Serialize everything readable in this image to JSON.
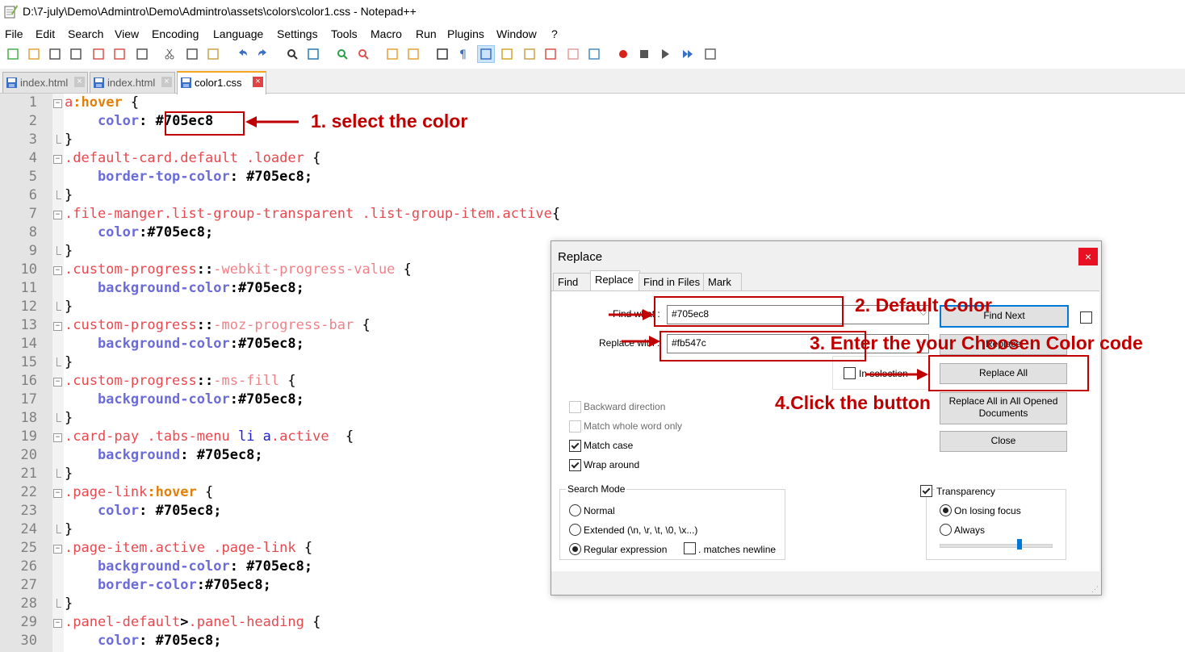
{
  "window": {
    "title": "D:\\7-july\\Demo\\Admintro\\Demo\\Admintro\\assets\\colors\\color1.css - Notepad++"
  },
  "menu": [
    "File",
    "Edit",
    "Search",
    "View",
    "Encoding",
    "Language",
    "Settings",
    "Tools",
    "Macro",
    "Run",
    "Plugins",
    "Window",
    "?"
  ],
  "tabs": [
    {
      "label": "index.html",
      "active": false
    },
    {
      "label": "index.html",
      "active": false
    },
    {
      "label": "color1.css",
      "active": true
    }
  ],
  "code_lines": [
    {
      "n": "1",
      "t": [
        [
          "a",
          "s-red"
        ],
        [
          ":hover",
          "s-or"
        ],
        [
          " {",
          "s-bl"
        ]
      ]
    },
    {
      "n": "2",
      "t": [
        [
          "    color",
          "s-blue"
        ],
        [
          ": ",
          "s-dk"
        ],
        [
          "#705ec8",
          "s-dk"
        ]
      ]
    },
    {
      "n": "3",
      "t": [
        [
          "}",
          "s-bl"
        ]
      ]
    },
    {
      "n": "4",
      "t": [
        [
          ".default-card.default",
          "s-red"
        ],
        [
          " .loader",
          "s-red"
        ],
        [
          " {",
          "s-bl"
        ]
      ]
    },
    {
      "n": "5",
      "t": [
        [
          "    border-top-color",
          "s-blue"
        ],
        [
          ": #705ec8;",
          "s-dk"
        ]
      ]
    },
    {
      "n": "6",
      "t": [
        [
          "}",
          "s-bl"
        ]
      ]
    },
    {
      "n": "7",
      "t": [
        [
          ".file-manger.list-group-transparent",
          "s-red"
        ],
        [
          " .list-group-item.active",
          "s-red"
        ],
        [
          "{",
          "s-bl"
        ]
      ]
    },
    {
      "n": "8",
      "t": [
        [
          "    color",
          "s-blue"
        ],
        [
          ":#705ec8;",
          "s-dk"
        ]
      ]
    },
    {
      "n": "9",
      "t": [
        [
          "}",
          "s-bl"
        ]
      ]
    },
    {
      "n": "10",
      "t": [
        [
          ".custom-progress",
          "s-red"
        ],
        [
          "::",
          "s-dk"
        ],
        [
          "-webkit-progress-value",
          "s-pk"
        ],
        [
          " {",
          "s-bl"
        ]
      ]
    },
    {
      "n": "11",
      "t": [
        [
          "    background-color",
          "s-blue"
        ],
        [
          ":#705ec8;",
          "s-dk"
        ]
      ]
    },
    {
      "n": "12",
      "t": [
        [
          "}",
          "s-bl"
        ]
      ]
    },
    {
      "n": "13",
      "t": [
        [
          ".custom-progress",
          "s-red"
        ],
        [
          "::",
          "s-dk"
        ],
        [
          "-moz-progress-bar",
          "s-pk"
        ],
        [
          " {",
          "s-bl"
        ]
      ]
    },
    {
      "n": "14",
      "t": [
        [
          "    background-color",
          "s-blue"
        ],
        [
          ":#705ec8;",
          "s-dk"
        ]
      ]
    },
    {
      "n": "15",
      "t": [
        [
          "}",
          "s-bl"
        ]
      ]
    },
    {
      "n": "16",
      "t": [
        [
          ".custom-progress",
          "s-red"
        ],
        [
          "::",
          "s-dk"
        ],
        [
          "-ms-fill",
          "s-pk"
        ],
        [
          " {",
          "s-bl"
        ]
      ]
    },
    {
      "n": "17",
      "t": [
        [
          "    background-color",
          "s-blue"
        ],
        [
          ":#705ec8;",
          "s-dk"
        ]
      ]
    },
    {
      "n": "18",
      "t": [
        [
          "}",
          "s-bl"
        ]
      ]
    },
    {
      "n": "19",
      "t": [
        [
          ".card-pay",
          "s-red"
        ],
        [
          " .tabs-menu",
          "s-red"
        ],
        [
          " li",
          "s-nv"
        ],
        [
          " a",
          "s-nv"
        ],
        [
          ".active",
          "s-red"
        ],
        [
          "  {",
          "s-bl"
        ]
      ]
    },
    {
      "n": "20",
      "t": [
        [
          "    background",
          "s-blue"
        ],
        [
          ": #705ec8;",
          "s-dk"
        ]
      ]
    },
    {
      "n": "21",
      "t": [
        [
          "}",
          "s-bl"
        ]
      ]
    },
    {
      "n": "22",
      "t": [
        [
          ".page-link",
          "s-red"
        ],
        [
          ":hover",
          "s-or"
        ],
        [
          " {",
          "s-bl"
        ]
      ]
    },
    {
      "n": "23",
      "t": [
        [
          "    color",
          "s-blue"
        ],
        [
          ": #705ec8;",
          "s-dk"
        ]
      ]
    },
    {
      "n": "24",
      "t": [
        [
          "}",
          "s-bl"
        ]
      ]
    },
    {
      "n": "25",
      "t": [
        [
          ".page-item.active",
          "s-red"
        ],
        [
          " .page-link",
          "s-red"
        ],
        [
          " {",
          "s-bl"
        ]
      ]
    },
    {
      "n": "26",
      "t": [
        [
          "    background-color",
          "s-blue"
        ],
        [
          ": #705ec8;",
          "s-dk"
        ]
      ]
    },
    {
      "n": "27",
      "t": [
        [
          "    border-color",
          "s-blue"
        ],
        [
          ":#705ec8;",
          "s-dk"
        ]
      ]
    },
    {
      "n": "28",
      "t": [
        [
          "}",
          "s-bl"
        ]
      ]
    },
    {
      "n": "29",
      "t": [
        [
          ".panel-default",
          "s-red"
        ],
        [
          ">",
          "s-dk"
        ],
        [
          ".panel-heading",
          "s-red"
        ],
        [
          " {",
          "s-bl"
        ]
      ]
    },
    {
      "n": "30",
      "t": [
        [
          "    color",
          "s-blue"
        ],
        [
          ": #705ec8;",
          "s-dk"
        ]
      ]
    }
  ],
  "dialog": {
    "title": "Replace",
    "close": "×",
    "tabs": [
      "Find",
      "Replace",
      "Find in Files",
      "Mark"
    ],
    "find_label": "Find what :",
    "find_value": "#705ec8",
    "replace_label": "Replace with :",
    "replace_value": "#fb547c",
    "in_selection": "In selection",
    "buttons": {
      "find_next": "Find Next",
      "replace": "Replace",
      "replace_all": "Replace All",
      "replace_all_opened": "Replace All in All Opened Documents",
      "close": "Close"
    },
    "options": {
      "backward": "Backward direction",
      "whole_word": "Match whole word only",
      "match_case": "Match case",
      "wrap": "Wrap around"
    },
    "search_mode": {
      "title": "Search Mode",
      "normal": "Normal",
      "extended": "Extended (\\n, \\r, \\t, \\0, \\x...)",
      "regex": "Regular expression",
      "newline": ". matches newline"
    },
    "transparency": {
      "title": "Transparency",
      "on_losing_focus": "On losing focus",
      "always": "Always",
      "slider_level": 0.72
    }
  },
  "annotations": {
    "a1": "1. select the color",
    "a2": "2. Default Color",
    "a3": "3. Enter the your Choosen Color code",
    "a4": "4.Click the button"
  },
  "colors": {
    "annotation": "#c00000",
    "selector": "#e8484f",
    "property": "#6c6cd8",
    "pseudo": "#e37f0b"
  }
}
